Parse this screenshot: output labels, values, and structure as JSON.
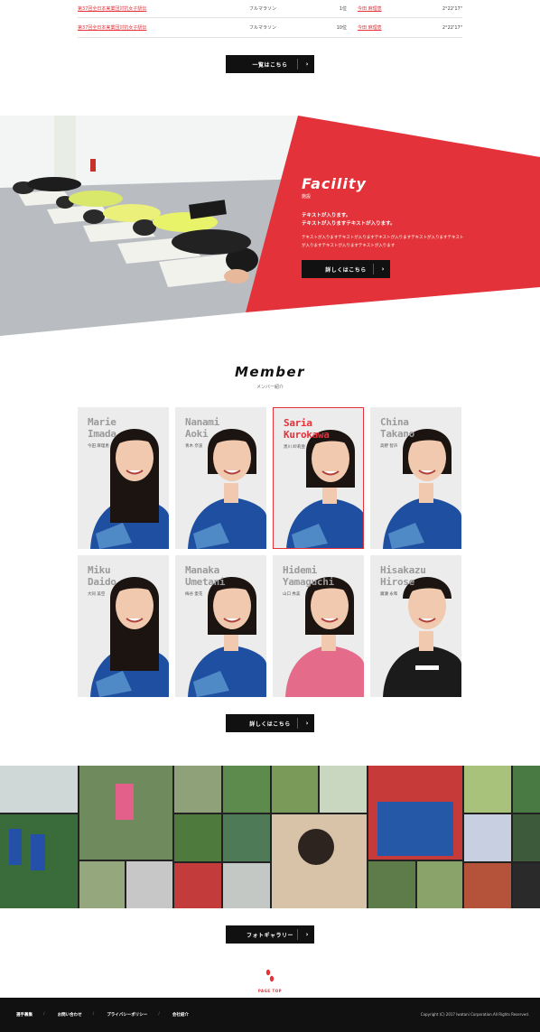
{
  "results": {
    "rows": [
      {
        "race": "第37回全日本実業団対抗女子駅伝",
        "category": "フルマラソン",
        "rank": "1位",
        "runner": "今田 麻理恵",
        "time": "2°22'17\""
      },
      {
        "race": "第37回全日本実業団対抗女子駅伝",
        "category": "フルマラソン",
        "rank": "10位",
        "runner": "今田 麻理恵",
        "time": "2°22'17\""
      }
    ],
    "list_button": "一覧はこちら"
  },
  "facility": {
    "title": "Facility",
    "subtitle": "施設",
    "lead": "テキストが入ります。\nテキストが入りますテキストが入ります。",
    "body": "テキストが入りますテキストが入りますテキストが入りますテキストが入りますテキストが入りますテキストが入りますテキストが入ります",
    "button": "詳しくはこちら"
  },
  "member": {
    "title": "Member",
    "subtitle": "メンバー紹介",
    "cards": [
      {
        "en": "Marie\nImada",
        "jp": "今田 麻理恵",
        "active": false,
        "jacket": "blue",
        "hair": "long"
      },
      {
        "en": "Nanami\nAoki",
        "jp": "青木 奈波",
        "active": false,
        "jacket": "blue",
        "hair": "short"
      },
      {
        "en": "Saria\nKurokawa",
        "jp": "黒川 紗莉亜",
        "active": true,
        "jacket": "blue",
        "hair": "bob"
      },
      {
        "en": "China\nTakano",
        "jp": "高野 智声",
        "active": false,
        "jacket": "blue",
        "hair": "short"
      },
      {
        "en": "Miku\nDaido",
        "jp": "大同 美空",
        "active": false,
        "jacket": "blue",
        "hair": "long"
      },
      {
        "en": "Manaka\nUmetani",
        "jp": "梅谷 愛花",
        "active": false,
        "jacket": "blue",
        "hair": "bob"
      },
      {
        "en": "Hidemi\nYamaguchi",
        "jp": "山口 秀美",
        "active": false,
        "jacket": "pink",
        "hair": "bob"
      },
      {
        "en": "Hisakazu\nHirose",
        "jp": "廣瀬 永和",
        "active": false,
        "jacket": "black",
        "hair": "man"
      }
    ],
    "button": "詳しくはこちら"
  },
  "gallery": {
    "button": "フォトギャラリー"
  },
  "page_top": {
    "label": "PAGE TOP"
  },
  "footer": {
    "links": [
      "選手募集",
      "お問い合わせ",
      "プライバシーポリシー",
      "会社紹介"
    ],
    "copyright": "Copyright (C) 2017 Iwatani Corporation.All Rights Reserved."
  },
  "colors": {
    "accent": "#e3323a",
    "dark": "#111111",
    "jacket_blue": "#1e4fa0",
    "jacket_pink": "#e46b8a"
  }
}
